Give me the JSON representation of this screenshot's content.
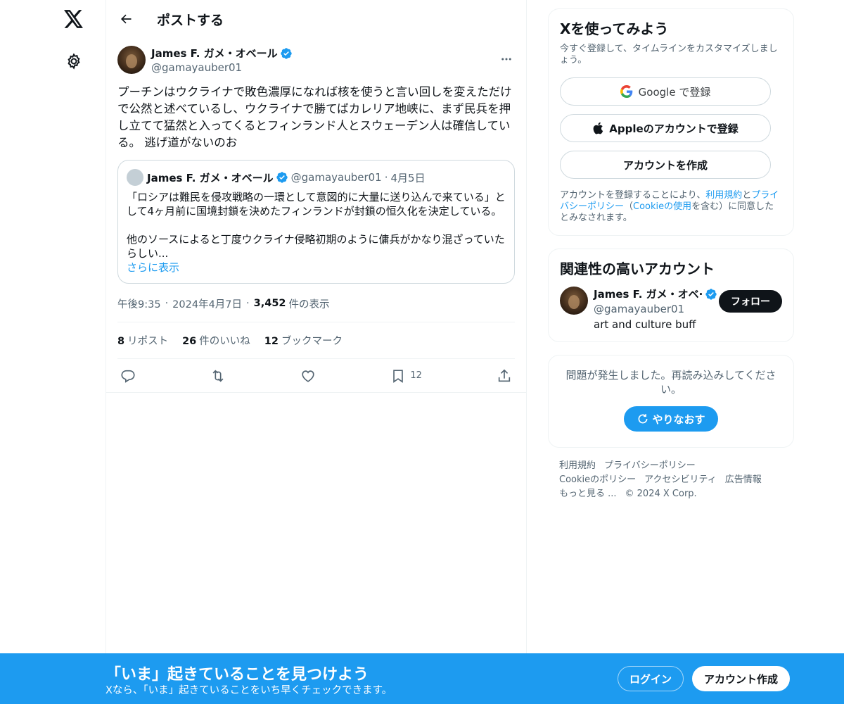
{
  "header": {
    "title": "ポストする"
  },
  "post": {
    "author_name": "James F. ガメ・オベール",
    "author_handle": "@gamayauber01",
    "text": "プーチンはウクライナで敗色濃厚になれば核を使うと言い回しを変えただけで公然と述べているし、ウクライナで勝てばカレリア地峡に、まず民兵を押し立てて猛然と入ってくるとフィンランド人とスウェーデン人は確信している。 逃げ道がないのお",
    "quote": {
      "author_name": "James F. ガメ・オベール",
      "author_handle": "@gamayauber01",
      "dot": "·",
      "date": "4月5日",
      "text": "「ロシアは難民を侵攻戦略の一環として意図的に大量に送り込んで来ている」として4ヶ月前に国境封鎖を決めたフィンランドが封鎖の恒久化を決定している。\n\n他のソースによると丁度ウクライナ侵略初期のように傭兵がかなり混ざっていたらしい...",
      "show_more": "さらに表示"
    },
    "time": "午後9:35",
    "date": "2024年4月7日",
    "views_count": "3,452",
    "views_label": "件の表示",
    "sep": "·",
    "stats": {
      "reposts_count": "8",
      "reposts_label": "リポスト",
      "likes_count": "26",
      "likes_label": "件のいいね",
      "bookmarks_count": "12",
      "bookmarks_label": "ブックマーク"
    },
    "actions": {
      "bookmark_count": "12"
    }
  },
  "signup_card": {
    "title": "Xを使ってみよう",
    "subtitle": "今すぐ登録して、タイムラインをカスタマイズしましょう。",
    "google_label": "Google で登録",
    "apple_label": "Appleのアカウントで登録",
    "create_label": "アカウントを作成",
    "terms_prefix": "アカウントを登録することにより、",
    "terms_link": "利用規約",
    "terms_and": "と",
    "privacy_link": "プライバシーポリシー",
    "terms_mid": "（",
    "cookie_link": "Cookieの使用",
    "terms_suffix": "を含む）に同意したとみなされます。"
  },
  "related": {
    "title": "関連性の高いアカウント",
    "name": "James F. ガメ・オベ·",
    "handle": "@gamayauber01",
    "bio": "art and culture buff",
    "follow_label": "フォロー"
  },
  "error_card": {
    "text": "問題が発生しました。再読み込みしてください。",
    "retry_label": "やりなおす"
  },
  "footer": {
    "terms": "利用規約",
    "privacy": "プライバシーポリシー",
    "cookie": "Cookieのポリシー",
    "accessibility": "アクセシビリティ",
    "ads": "広告情報",
    "more": "もっと見る ...",
    "copyright": "© 2024 X Corp."
  },
  "banner": {
    "title": "「いま」起きていることを見つけよう",
    "subtitle": "Xなら、「いま」起きていることをいち早くチェックできます。",
    "login_label": "ログイン",
    "signup_label": "アカウント作成"
  },
  "colors": {
    "accent": "#1d9bf0",
    "text": "#0f1419",
    "muted": "#536471"
  }
}
